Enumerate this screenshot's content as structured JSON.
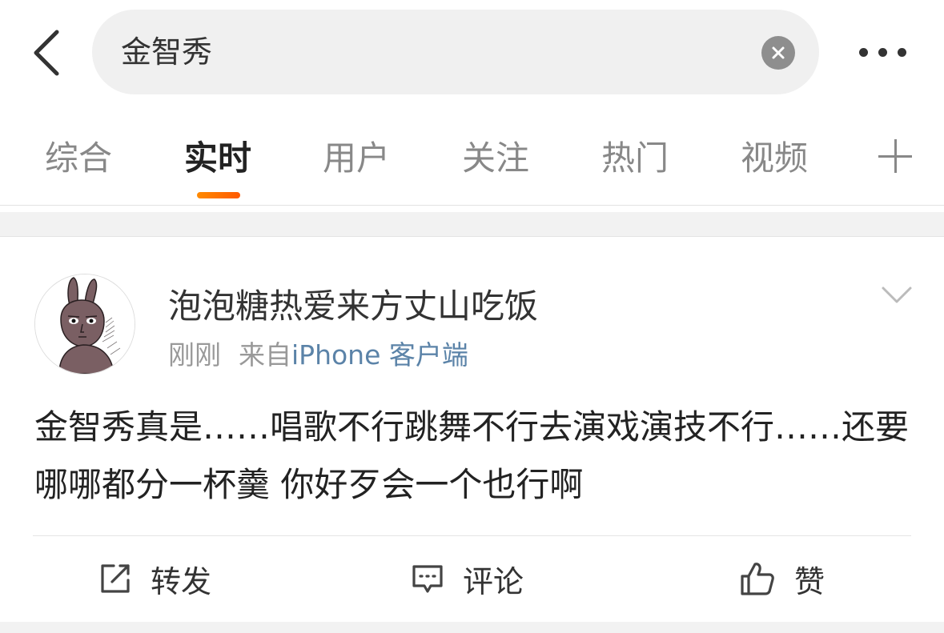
{
  "search": {
    "query": "金智秀"
  },
  "tabs": [
    {
      "label": "综合"
    },
    {
      "label": "实时",
      "active": true
    },
    {
      "label": "用户"
    },
    {
      "label": "关注"
    },
    {
      "label": "热门"
    },
    {
      "label": "视频"
    }
  ],
  "post": {
    "username": "泡泡糖热爱来方丈山吃饭",
    "time": "刚刚",
    "from_prefix": "来自",
    "source": "iPhone 客户端",
    "text": "金智秀真是……唱歌不行跳舞不行去演戏演技不行……还要哪哪都分一杯羹 你好歹会一个也行啊"
  },
  "actions": {
    "repost": "转发",
    "comment": "评论",
    "like": "赞"
  },
  "colors": {
    "accent": "#ff7a00",
    "link": "#5b83a8",
    "muted": "#999999",
    "text": "#333333"
  },
  "icons": {
    "back": "chevron-left-icon",
    "clear": "clear-icon",
    "more": "more-dots-icon",
    "add": "plus-icon",
    "post_menu": "chevron-down-icon",
    "repost": "share-icon",
    "comment": "comment-icon",
    "like": "thumbs-up-icon"
  }
}
